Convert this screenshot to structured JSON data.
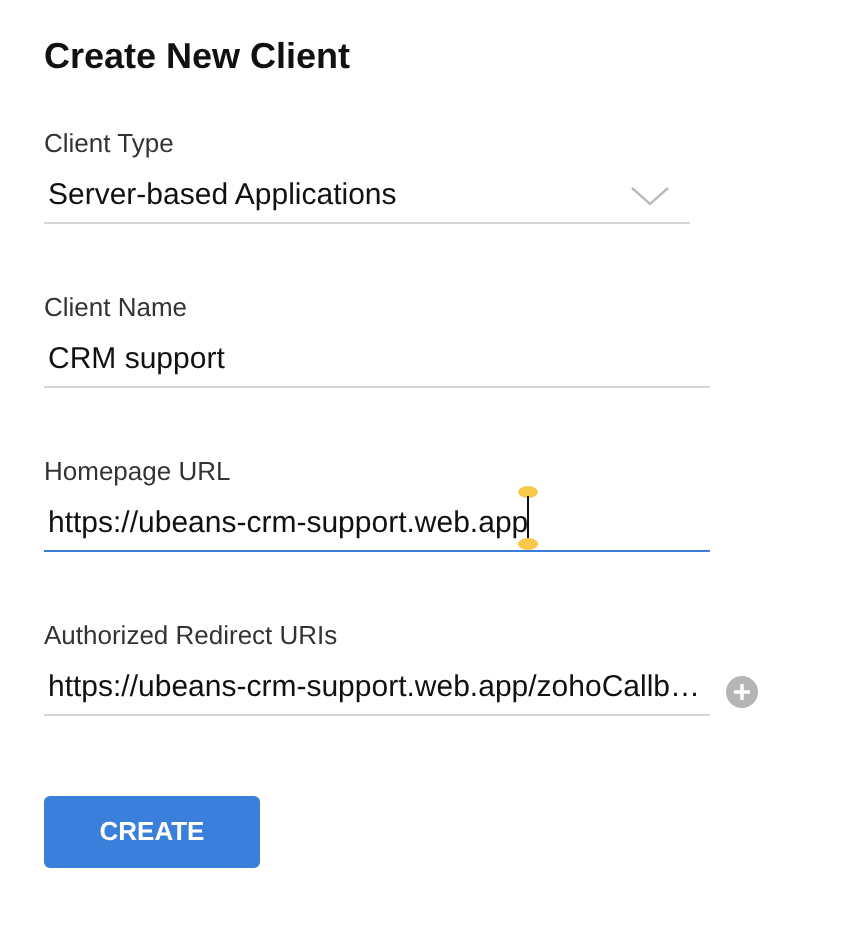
{
  "title": "Create New Client",
  "fields": [
    {
      "kind": "select",
      "label": "Client Type",
      "value": "Server-based Applications",
      "focused": false
    },
    {
      "kind": "text",
      "label": "Client Name",
      "value": "CRM support",
      "focused": false
    },
    {
      "kind": "text",
      "label": "Homepage URL",
      "value": "https://ubeans-crm-support.web.app",
      "focused": true
    },
    {
      "kind": "add",
      "label": "Authorized Redirect URIs",
      "value": "https://ubeans-crm-support.web.app/zohoCallb…",
      "focused": false
    }
  ],
  "button": "CREATE"
}
